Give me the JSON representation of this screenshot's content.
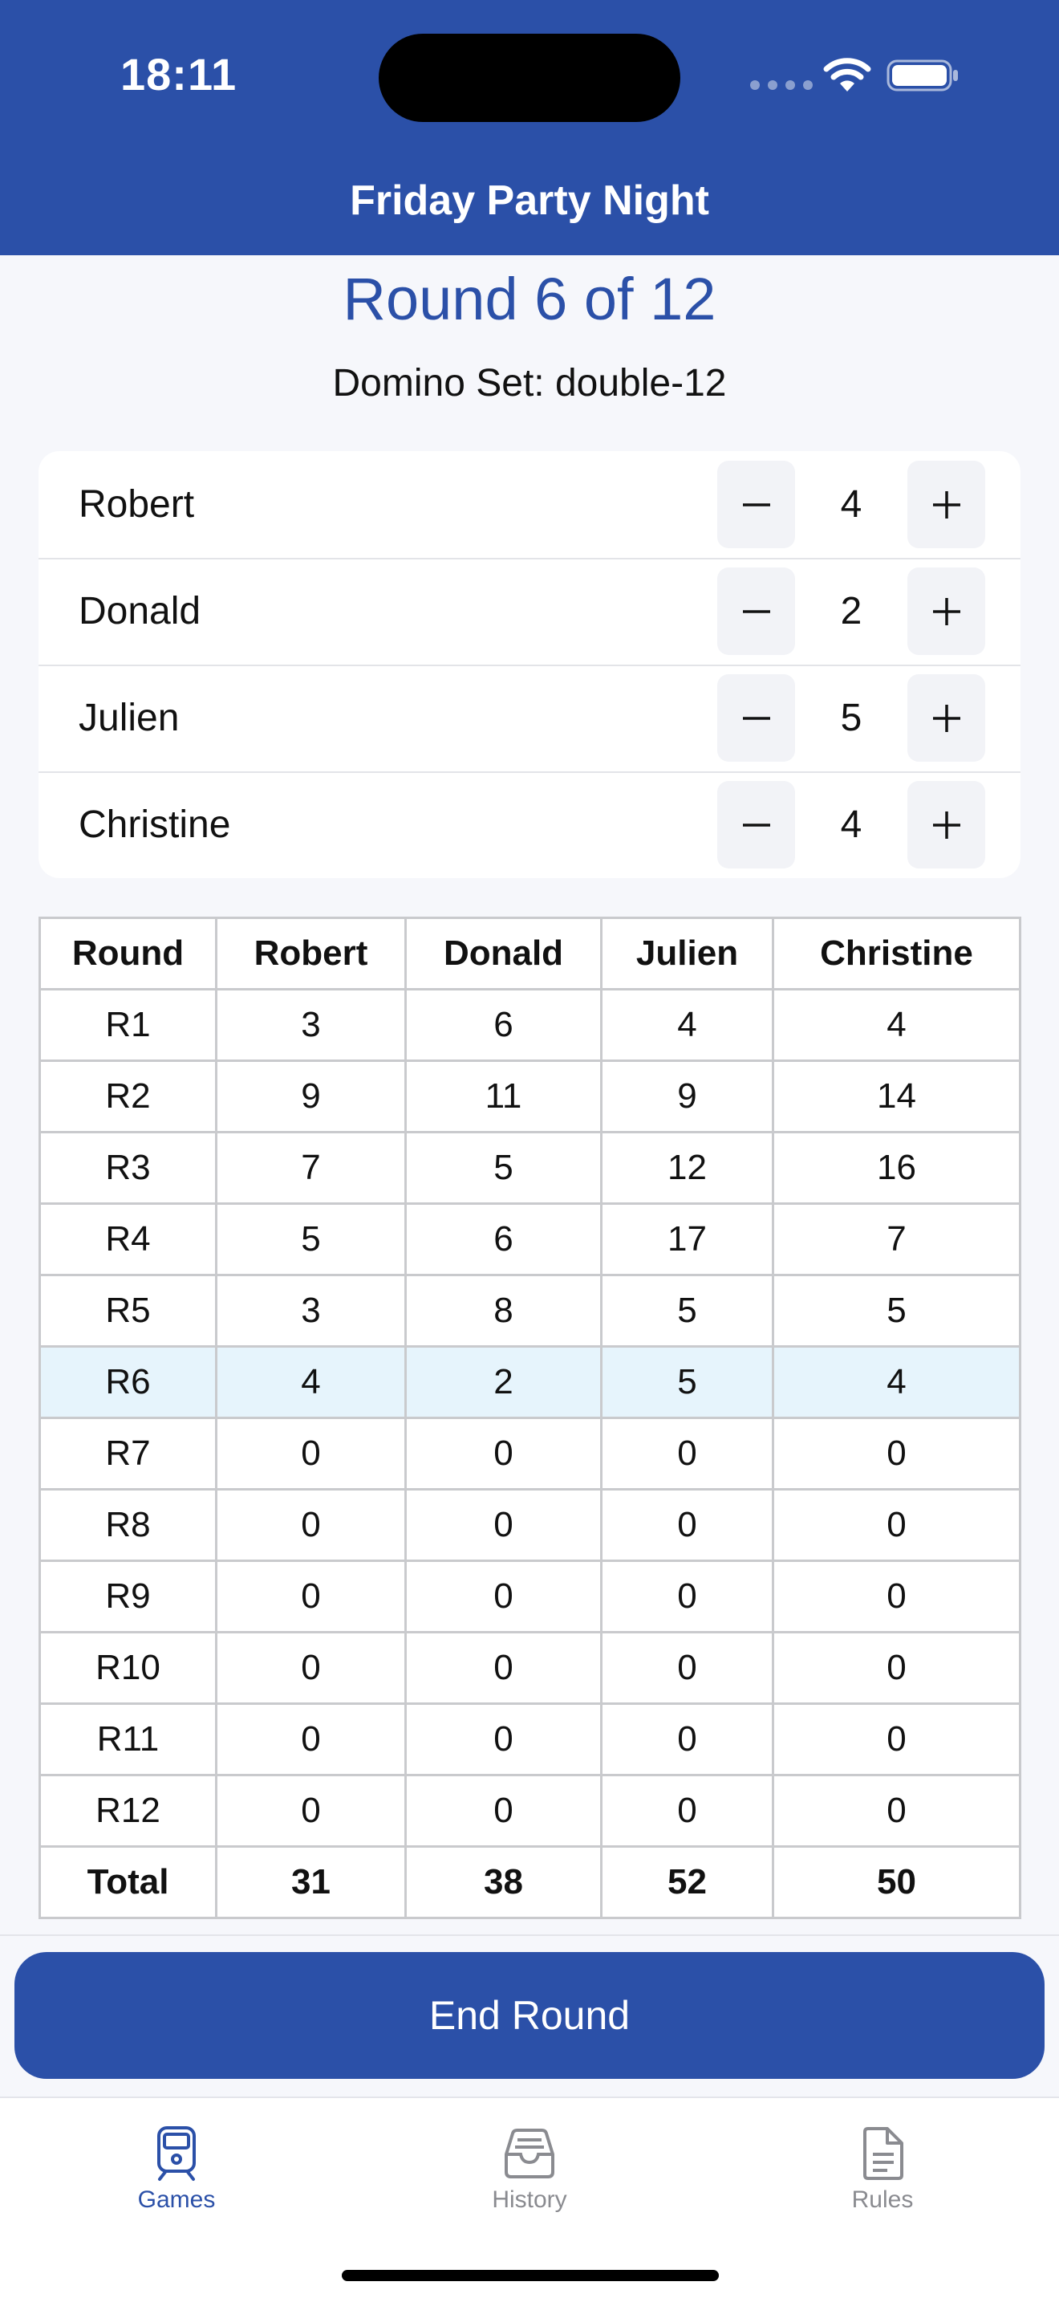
{
  "status_bar": {
    "time": "18:11"
  },
  "nav": {
    "title": "Friday Party Night"
  },
  "round": {
    "title": "Round 6 of 12",
    "domino_set": "Domino Set: double-12"
  },
  "players": [
    {
      "name": "Robert",
      "score": "4"
    },
    {
      "name": "Donald",
      "score": "2"
    },
    {
      "name": "Julien",
      "score": "5"
    },
    {
      "name": "Christine",
      "score": "4"
    }
  ],
  "stepper": {
    "minus": "−",
    "plus": "+"
  },
  "table": {
    "headers": [
      "Round",
      "Robert",
      "Donald",
      "Julien",
      "Christine"
    ],
    "rows": [
      [
        "R1",
        "3",
        "6",
        "4",
        "4"
      ],
      [
        "R2",
        "9",
        "11",
        "9",
        "14"
      ],
      [
        "R3",
        "7",
        "5",
        "12",
        "16"
      ],
      [
        "R4",
        "5",
        "6",
        "17",
        "7"
      ],
      [
        "R5",
        "3",
        "8",
        "5",
        "5"
      ],
      [
        "R6",
        "4",
        "2",
        "5",
        "4"
      ],
      [
        "R7",
        "0",
        "0",
        "0",
        "0"
      ],
      [
        "R8",
        "0",
        "0",
        "0",
        "0"
      ],
      [
        "R9",
        "0",
        "0",
        "0",
        "0"
      ],
      [
        "R10",
        "0",
        "0",
        "0",
        "0"
      ],
      [
        "R11",
        "0",
        "0",
        "0",
        "0"
      ],
      [
        "R12",
        "0",
        "0",
        "0",
        "0"
      ]
    ],
    "current_row": "R6",
    "total": [
      "Total",
      "31",
      "38",
      "52",
      "50"
    ]
  },
  "actions": {
    "end_round": "End Round"
  },
  "tabs": [
    {
      "label": "Games",
      "icon": "train-icon",
      "active": true
    },
    {
      "label": "History",
      "icon": "tray-icon",
      "active": false
    },
    {
      "label": "Rules",
      "icon": "document-icon",
      "active": false
    }
  ],
  "colors": {
    "brand": "#2b50a8",
    "current_row": "#e6f4fc",
    "inactive_tab": "#8a8b90"
  }
}
